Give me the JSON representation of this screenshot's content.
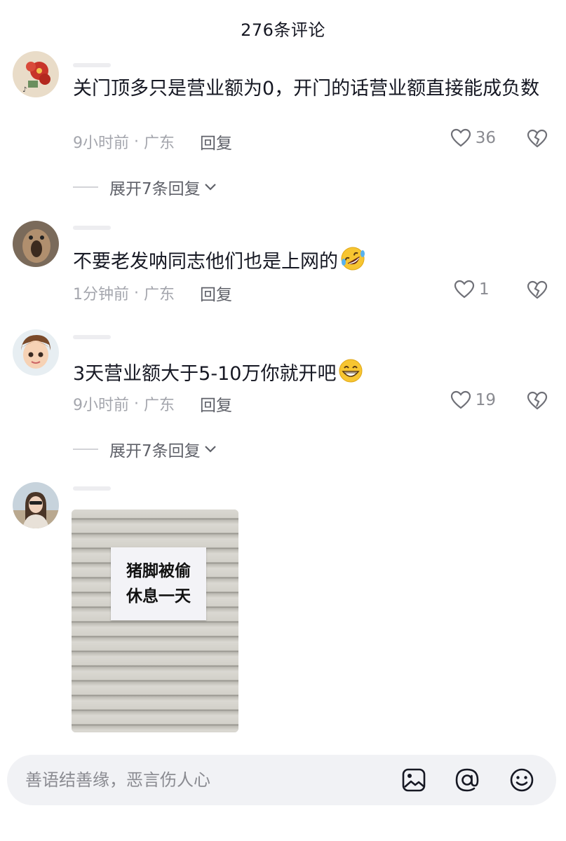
{
  "header": {
    "title": "276条评论"
  },
  "comments": [
    {
      "text": "关门顶多只是营业额为0，开门的话营业额直接能成负数",
      "time": "9小时前",
      "location": "广东",
      "reply_label": "回复",
      "likes": "36",
      "expand_label": "展开7条回复"
    },
    {
      "text": "不要老发呐同志他们也是上网的",
      "emoji": "rolling-on-floor-laughing-emoji",
      "time": "1分钟前",
      "location": "广东",
      "reply_label": "回复",
      "likes": "1"
    },
    {
      "text": "3天营业额大于5-10万你就开吧",
      "emoji": "grinning-face-emoji",
      "time": "9小时前",
      "location": "广东",
      "reply_label": "回复",
      "likes": "19",
      "expand_label": "展开7条回复"
    },
    {
      "image": {
        "notice_line1": "猪脚被偷",
        "notice_line2": "休息一天"
      }
    }
  ],
  "input": {
    "placeholder": "善语结善缘，恶言伤人心"
  },
  "icons": [
    "heart-icon",
    "broken-heart-icon",
    "chevron-down-icon",
    "image-icon",
    "at-icon",
    "emoji-icon"
  ],
  "colors": {
    "text": "#161823",
    "meta": "#a4a6ad",
    "input_bg": "#f1f2f5"
  }
}
